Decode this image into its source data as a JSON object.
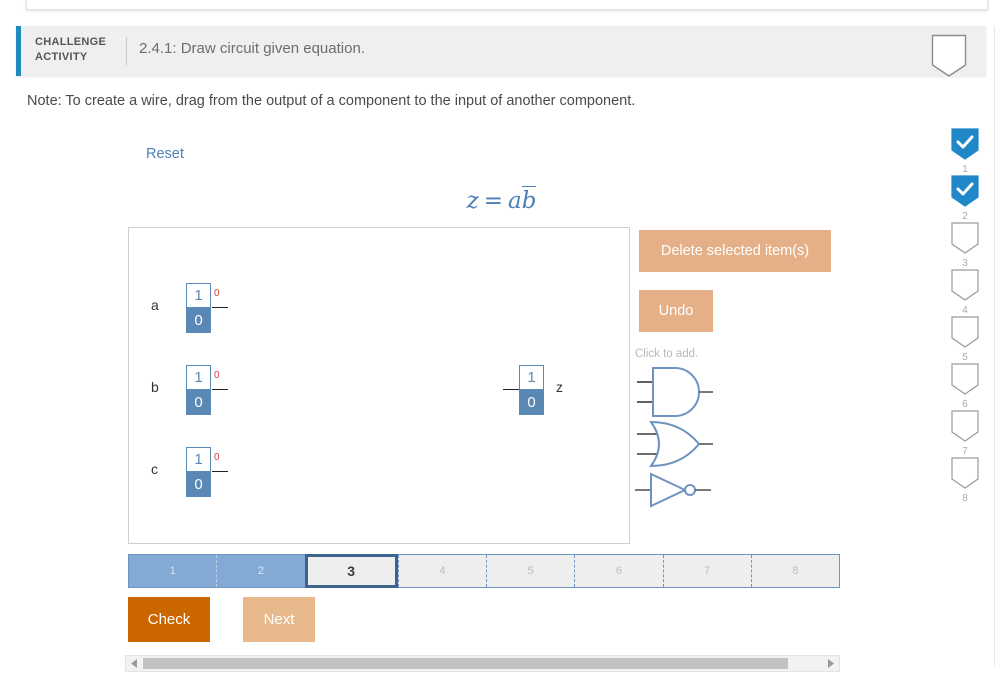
{
  "header": {
    "kicker": "CHALLENGE ACTIVITY",
    "title": "2.4.1: Draw circuit given equation.",
    "bookmark_icon": "bookmark-shield-icon",
    "accent_color": "#1f8ac0",
    "background_color": "#efefef"
  },
  "note": "Note: To create a wire, drag from the output of a component to the input of another component.",
  "reset_label": "Reset",
  "equation": {
    "lhs": "z",
    "equals": "=",
    "term_a": "a",
    "term_b_overline": "b",
    "color": "#4d80b7"
  },
  "canvas": {
    "inputs": [
      {
        "label": "a",
        "on_value": "1",
        "off_value": "0",
        "current_value": "0"
      },
      {
        "label": "b",
        "on_value": "1",
        "off_value": "0",
        "current_value": "0"
      },
      {
        "label": "c",
        "on_value": "1",
        "off_value": "0",
        "current_value": "0"
      }
    ],
    "output": {
      "label": "z",
      "on_value": "1",
      "off_value": "0"
    }
  },
  "tools": {
    "delete_label": "Delete selected item(s)",
    "undo_label": "Undo",
    "click_to_add": "Click to add.",
    "button_color": "#e5b087",
    "gates": [
      {
        "name": "and-gate",
        "inputs": 2
      },
      {
        "name": "or-gate",
        "inputs": 2
      },
      {
        "name": "not-gate",
        "inputs": 1
      }
    ]
  },
  "steps": [
    {
      "label": "1",
      "state": "done"
    },
    {
      "label": "2",
      "state": "done"
    },
    {
      "label": "3",
      "state": "current"
    },
    {
      "label": "4",
      "state": "todo"
    },
    {
      "label": "5",
      "state": "todo"
    },
    {
      "label": "6",
      "state": "todo"
    },
    {
      "label": "7",
      "state": "todo"
    },
    {
      "label": "8",
      "state": "todo"
    }
  ],
  "actions": {
    "check_label": "Check",
    "check_color": "#cc6600",
    "next_label": "Next",
    "next_color": "#e8b98c"
  },
  "progress_shields": [
    {
      "number": "1",
      "checked": true
    },
    {
      "number": "2",
      "checked": true
    },
    {
      "number": "3",
      "checked": false
    },
    {
      "number": "4",
      "checked": false
    },
    {
      "number": "5",
      "checked": false
    },
    {
      "number": "6",
      "checked": false
    },
    {
      "number": "7",
      "checked": false
    },
    {
      "number": "8",
      "checked": false
    }
  ],
  "scrollbar": {
    "left_arrow": "triangle-left-icon",
    "right_arrow": "triangle-right-icon"
  }
}
